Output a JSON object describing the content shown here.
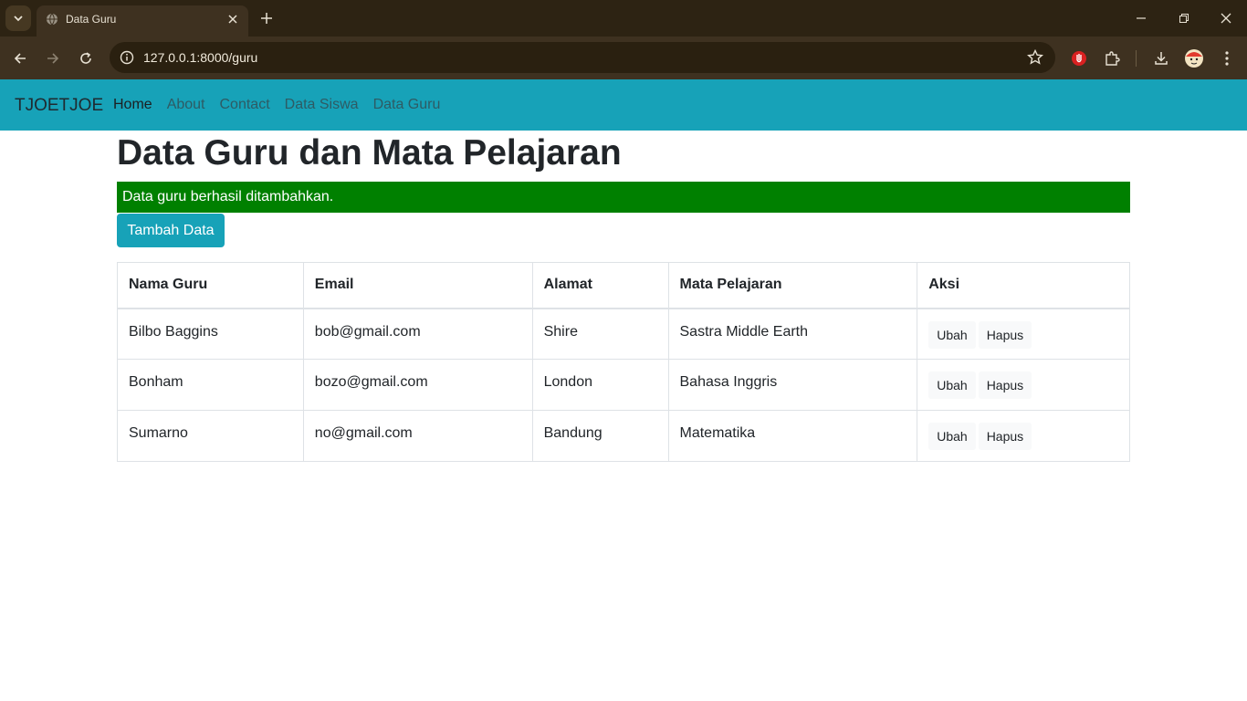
{
  "browser": {
    "tab_title": "Data Guru",
    "url": "127.0.0.1:8000/guru"
  },
  "navbar": {
    "brand": "TJOETJOE",
    "links": [
      "Home",
      "About",
      "Contact",
      "Data Siswa",
      "Data Guru"
    ]
  },
  "page": {
    "title": "Data Guru dan Mata Pelajaran",
    "alert": "Data guru berhasil ditambahkan.",
    "add_button": "Tambah Data"
  },
  "table": {
    "headers": [
      "Nama Guru",
      "Email",
      "Alamat",
      "Mata Pelajaran",
      "Aksi"
    ],
    "rows": [
      {
        "nama": "Bilbo Baggins",
        "email": "bob@gmail.com",
        "alamat": "Shire",
        "mapel": "Sastra Middle Earth",
        "edit": "Ubah",
        "delete": "Hapus"
      },
      {
        "nama": "Bonham",
        "email": "bozo@gmail.com",
        "alamat": "London",
        "mapel": "Bahasa Inggris",
        "edit": "Ubah",
        "delete": "Hapus"
      },
      {
        "nama": "Sumarno",
        "email": "no@gmail.com",
        "alamat": "Bandung",
        "mapel": "Matematika",
        "edit": "Ubah",
        "delete": "Hapus"
      }
    ]
  },
  "colors": {
    "navbar": "#17a2b8",
    "alert": "#008000",
    "chrome": "#3e3120"
  }
}
